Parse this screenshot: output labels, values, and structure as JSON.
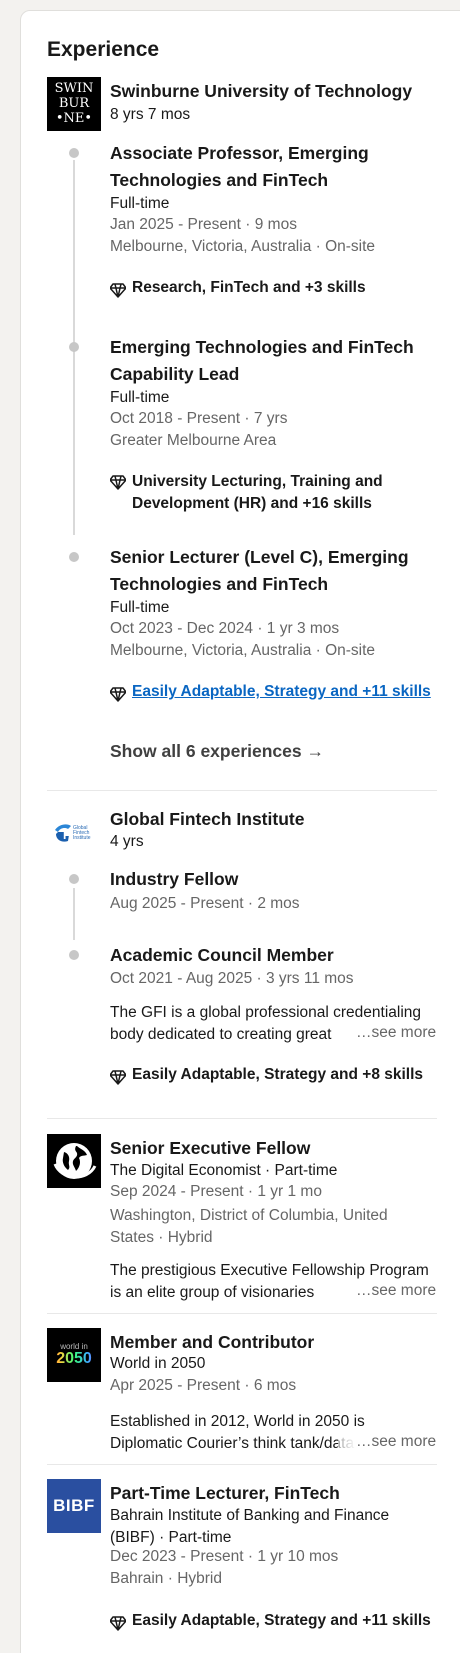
{
  "section": {
    "title": "Experience"
  },
  "swinburne": {
    "logo_lines": [
      "SWIN",
      "BUR",
      "•NE•"
    ],
    "name": "Swinburne University of Technology",
    "duration": "8 yrs 7 mos",
    "roles": [
      {
        "title": "Associate Professor, Emerging Technologies and FinTech",
        "type": "Full-time",
        "dates": "Jan 2025 - Present · 9 mos",
        "location": "Melbourne, Victoria, Australia · On-site",
        "skills": "Research, FinTech and +3 skills"
      },
      {
        "title": "Emerging Technologies and FinTech Capability Lead",
        "type": "Full-time",
        "dates": "Oct 2018 - Present · 7 yrs",
        "location": "Greater Melbourne Area",
        "skills": "University Lecturing, Training and Development (HR) and +16 skills"
      },
      {
        "title": "Senior Lecturer (Level C), Emerging Technologies and FinTech",
        "type": "Full-time",
        "dates": "Oct 2023 - Dec 2024 · 1 yr 3 mos",
        "location": "Melbourne, Victoria, Australia · On-site",
        "skills": "Easily Adaptable, Strategy and +11 skills"
      }
    ],
    "show_all": "Show all 6 experiences →"
  },
  "gfi": {
    "logo_text": "Global Fintech Institute",
    "name": "Global Fintech Institute",
    "duration": "4 yrs",
    "roles": [
      {
        "title": "Industry Fellow",
        "dates": "Aug 2025 - Present · 2 mos"
      },
      {
        "title": "Academic Council Member",
        "dates": "Oct 2021 - Aug 2025 · 3 yrs 11 mos",
        "description": "The GFI is a global professional credentialing body dedicated to creating great",
        "see_more": "…see more",
        "skills": "Easily Adaptable, Strategy and +8 skills"
      }
    ]
  },
  "digital_economist": {
    "title": "Senior Executive Fellow",
    "company": "The Digital Economist · Part-time",
    "dates": "Sep 2024 - Present · 1 yr 1 mo",
    "location": "Washington, District of Columbia, United States · Hybrid",
    "description": "The prestigious Executive Fellowship Program is an elite group of visionaries",
    "see_more": "…see more"
  },
  "world2050": {
    "logo_small": "world in",
    "logo_big": "2050",
    "title": "Member and Contributor",
    "company": "World in 2050",
    "dates": "Apr 2025 - Present · 6 mos",
    "description": "Established in 2012, World in 2050 is Diplomatic Courier’s think tank/data",
    "see_more": "…see more"
  },
  "bibf": {
    "logo_text": "BIBF",
    "title": "Part-Time Lecturer, FinTech",
    "company": "Bahrain Institute of Banking and Finance (BIBF) · Part-time",
    "dates": "Dec 2023 - Present · 1 yr 10 mos",
    "location": "Bahrain · Hybrid",
    "skills": "Easily Adaptable, Strategy and +11 skills"
  },
  "colors": {
    "link": "#0a66c2",
    "muted": "#666666",
    "bibf_blue": "#2a4fa0"
  }
}
